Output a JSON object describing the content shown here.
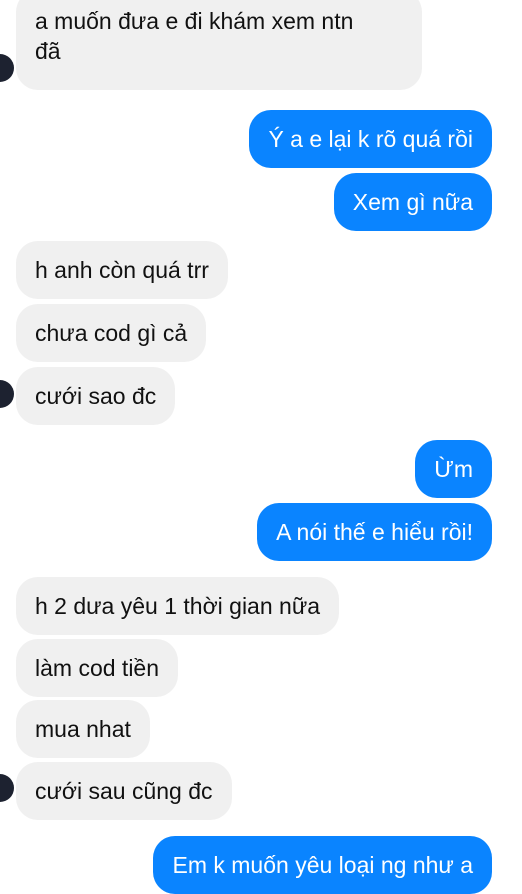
{
  "conversation": {
    "messages": [
      {
        "side": "in",
        "text": "a muốn đưa e đi khám xem ntn",
        "text2": "đã"
      },
      {
        "side": "out",
        "text": "Ý a e lại k rõ quá rồi"
      },
      {
        "side": "out",
        "text": "Xem gì nữa"
      },
      {
        "side": "in",
        "text": "h anh còn quá trr"
      },
      {
        "side": "in",
        "text": "chưa cod gì cả"
      },
      {
        "side": "in",
        "text": "cưới sao đc"
      },
      {
        "side": "out",
        "text": "Ừm"
      },
      {
        "side": "out",
        "text": "A nói thế e hiểu rồi!"
      },
      {
        "side": "in",
        "text": "h 2 dưa yêu 1 thời gian nữa"
      },
      {
        "side": "in",
        "text": "làm cod tiền"
      },
      {
        "side": "in",
        "text": "mua nhat"
      },
      {
        "side": "in",
        "text": "cưới sau cũng đc"
      },
      {
        "side": "out",
        "text": "Em k muốn yêu loại ng như a"
      }
    ]
  },
  "colors": {
    "incoming_bubble": "#f0f0f0",
    "outgoing_bubble": "#0a84ff",
    "incoming_text": "#111111",
    "outgoing_text": "#ffffff",
    "avatar": "#1d2230"
  }
}
